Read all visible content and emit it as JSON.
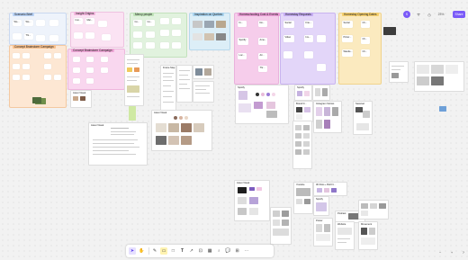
{
  "frames": {
    "f1": "Scenario Brief",
    "f2": "Insight Origins",
    "f3": "Mercy people",
    "f4": "Inspiration on Quebec",
    "f5": "Homeschooling Cost & Events",
    "f6": "Homestay Requests",
    "f7": "Homestay Opening Dates",
    "f8": "Concept Brainstorm Campaign",
    "f9": "Concept Brainstorm Campaign"
  },
  "stickies": {
    "s1": "Wo...",
    "s2": "Wo...",
    "s3": "Thi...",
    "s4": "Insi...",
    "s5": "Mar...",
    "s6": "Co...",
    "s7": "Co...",
    "s8": "Fi...",
    "s9": "Do...",
    "s10": "Spotify",
    "s11": "Ame...",
    "s12": "Loc...",
    "s13": "Air...",
    "s14": "Thr...",
    "s15": "Social",
    "s16": "Frie...",
    "s17": "Video",
    "s18": "Ins...",
    "s19": "Social",
    "s20": "Ch...",
    "s21": "Pinter...",
    "s22": "Ch...",
    "s23": "Wande...",
    "s24": "Ch..."
  },
  "cards": {
    "c1": "Spotify",
    "c2": "Asset Visual",
    "c3": "Asset Visual",
    "c4": "Frame Map",
    "c5": "Asset Visual",
    "c6": "Spotify",
    "c7": "Brand D...",
    "c8": "Instagram Stories",
    "c9": "Seasnac",
    "c10": "Asset Visual",
    "c11": "Youtube",
    "c12": "3D Dots + Bull Fl...",
    "c13": "Spotify",
    "c14": "Podcast",
    "c15": "Website",
    "c16": "Movement",
    "c17": "Event Themes",
    "c18": "Asset Visual",
    "c19": "Logo",
    "c20": "Youtube",
    "c21": "Poster",
    "c22": "Smoke..."
  },
  "header": {
    "avatar_initial": "S",
    "zoom": "23%",
    "share_label": "Share"
  },
  "footer": {
    "zoom_out": "−",
    "zoom_in": "+"
  },
  "colors": {
    "accent": "#7a5af8",
    "pink_frame": "#f6c7e8",
    "purple_frame": "#d9c9f7",
    "green_frame": "#d7ecd3",
    "yellow_frame": "#fbe9b9",
    "blue_frame": "#d6e6f7"
  }
}
